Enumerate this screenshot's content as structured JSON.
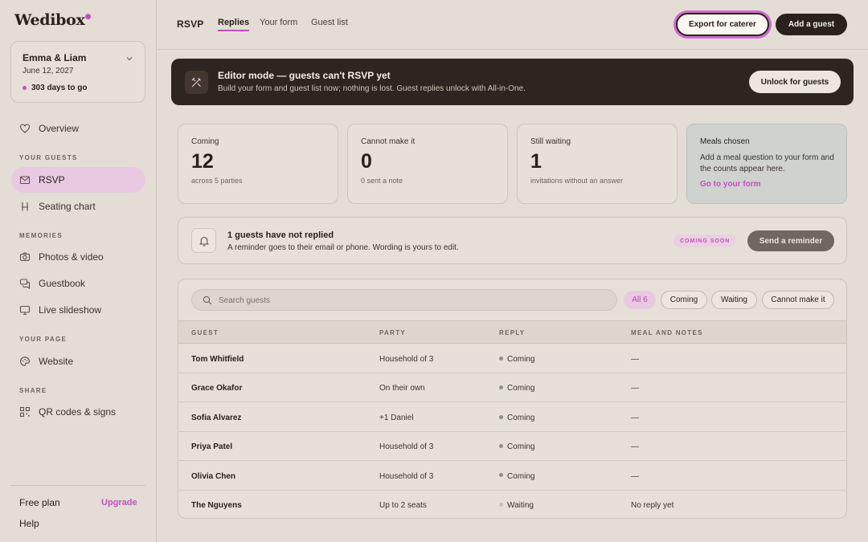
{
  "sidebar": {
    "logo": "Wedibox",
    "couple": {
      "name": "Emma & Liam",
      "date": "June 12, 2027",
      "countdown": "303 days to go"
    },
    "nav": {
      "overview": "Overview",
      "section_guests": "YOUR GUESTS",
      "rsvp": "RSVP",
      "seating": "Seating chart",
      "section_memories": "MEMORIES",
      "photos": "Photos & video",
      "guestbook": "Guestbook",
      "slideshow": "Live slideshow",
      "section_page": "YOUR PAGE",
      "website": "Website",
      "section_share": "SHARE",
      "qr": "QR codes & signs"
    },
    "plan": "Free plan",
    "upgrade": "Upgrade",
    "help": "Help"
  },
  "topbar": {
    "title": "RSVP",
    "tabs": [
      "Replies",
      "Your form",
      "Guest list"
    ],
    "export_label": "Export for caterer",
    "add_label": "Add a guest"
  },
  "banner": {
    "title": "Editor mode — guests can't RSVP yet",
    "subtitle": "Build your form and guest list now; nothing is lost. Guest replies unlock with All-in-One.",
    "button": "Unlock for guests"
  },
  "stats": [
    {
      "label": "Coming",
      "value": "12",
      "sub": "across 5 parties"
    },
    {
      "label": "Cannot make it",
      "value": "0",
      "sub": "0 sent a note"
    },
    {
      "label": "Still waiting",
      "value": "1",
      "sub": "invitations without an answer"
    }
  ],
  "meals": {
    "label": "Meals chosen",
    "text": "Add a meal question to your form and the counts appear here.",
    "link": "Go to your form"
  },
  "reminder": {
    "title": "1 guests have not replied",
    "subtitle": "A reminder goes to their email or phone. Wording is yours to edit.",
    "badge": "COMING SOON",
    "button": "Send a reminder"
  },
  "table": {
    "search_placeholder": "Search guests",
    "filters": [
      "All 6",
      "Coming",
      "Waiting",
      "Cannot make it"
    ],
    "headers": [
      "GUEST",
      "PARTY",
      "REPLY",
      "MEAL AND NOTES"
    ],
    "rows": [
      {
        "guest": "Tom Whitfield",
        "party": "Household of 3",
        "reply": "Coming",
        "notes": "—"
      },
      {
        "guest": "Grace Okafor",
        "party": "On their own",
        "reply": "Coming",
        "notes": "—"
      },
      {
        "guest": "Sofia Alvarez",
        "party": "+1 Daniel",
        "reply": "Coming",
        "notes": "—"
      },
      {
        "guest": "Priya Patel",
        "party": "Household of 3",
        "reply": "Coming",
        "notes": "—"
      },
      {
        "guest": "Olivia Chen",
        "party": "Household of 3",
        "reply": "Coming",
        "notes": "—"
      },
      {
        "guest": "The Nguyens",
        "party": "Up to 2 seats",
        "reply": "Waiting",
        "notes": "No reply yet"
      }
    ]
  },
  "colors": {
    "accent": "#c34fbf",
    "coming_dot": "#8a8f8a",
    "waiting_dot": "#c7c0b8"
  }
}
